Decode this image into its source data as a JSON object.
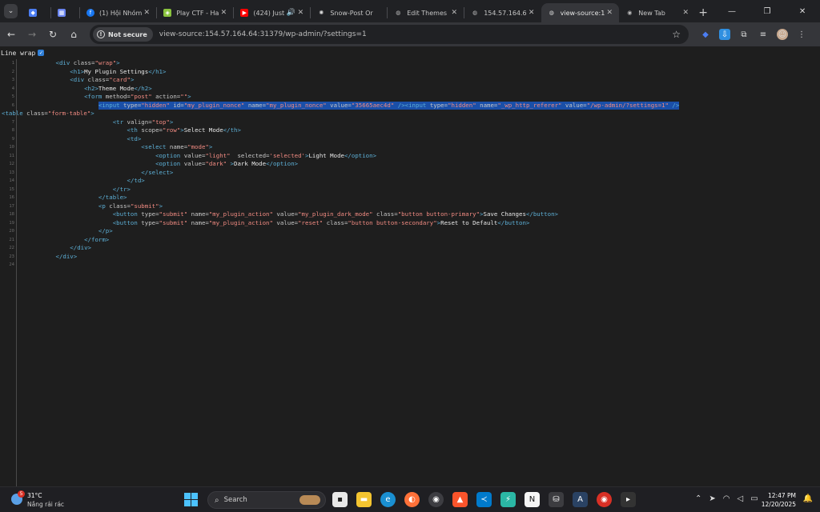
{
  "browser": {
    "tabs": [
      {
        "label": "",
        "favicon": "gem-icon",
        "color": "#4c7ef3"
      },
      {
        "label": "",
        "favicon": "calendar-icon",
        "color": "#6a85f0"
      },
      {
        "label": "(1) Hội Nhóm",
        "favicon": "facebook-icon",
        "color": "#1877f2"
      },
      {
        "label": "Play CTF - Ha",
        "favicon": "ctf-cube-icon",
        "color": "#8ac33e"
      },
      {
        "label": "(424) Just",
        "favicon": "youtube-icon",
        "color": "#ff0000"
      },
      {
        "label": "Snow-Post Or",
        "favicon": "snow-icon",
        "color": "#9aa0a6"
      },
      {
        "label": "Edit Themes",
        "favicon": "globe-icon",
        "color": "#9aa0a6"
      },
      {
        "label": "154.57.164.6",
        "favicon": "globe-icon",
        "color": "#9aa0a6"
      },
      {
        "label": "view-source:1",
        "favicon": "globe-icon",
        "color": "#9aa0a6"
      },
      {
        "label": "New Tab",
        "favicon": "chrome-icon",
        "color": "#9aa0a6"
      }
    ],
    "security_label": "Not secure",
    "url": "view-source:154.57.164.64:31379/wp-admin/?settings=1"
  },
  "viewsource": {
    "wrap_label": "Line wrap"
  },
  "source_lines": [
    {
      "n": "1",
      "indent": 5,
      "tokens": [
        [
          "t",
          "<div "
        ],
        [
          "a",
          "class="
        ],
        [
          "v",
          "\"wrap\""
        ],
        [
          "t",
          ">"
        ]
      ]
    },
    {
      "n": "2",
      "indent": 7,
      "tokens": [
        [
          "t",
          "<h1>"
        ],
        [
          "x",
          "My Plugin Settings"
        ],
        [
          "t",
          "</h1>"
        ]
      ]
    },
    {
      "n": "3",
      "indent": 7,
      "tokens": [
        [
          "t",
          "<div "
        ],
        [
          "a",
          "class="
        ],
        [
          "v",
          "\"card\""
        ],
        [
          "t",
          ">"
        ]
      ]
    },
    {
      "n": "4",
      "indent": 9,
      "tokens": [
        [
          "t",
          "<h2>"
        ],
        [
          "x",
          "Theme Mode"
        ],
        [
          "t",
          "</h2>"
        ]
      ]
    },
    {
      "n": "5",
      "indent": 9,
      "tokens": [
        [
          "t",
          "<form "
        ],
        [
          "a",
          "method="
        ],
        [
          "v",
          "\"post\""
        ],
        [
          "a",
          " action="
        ],
        [
          "v",
          "\"\""
        ],
        [
          "t",
          ">"
        ]
      ]
    },
    {
      "n": "6",
      "indent": 11,
      "hl": true,
      "tokens": [
        [
          "t",
          "<input "
        ],
        [
          "a",
          "type="
        ],
        [
          "v",
          "\"hidden\""
        ],
        [
          "a",
          " id="
        ],
        [
          "v",
          "\"my_plugin_nonce\""
        ],
        [
          "a",
          " name="
        ],
        [
          "v",
          "\"my_plugin_nonce\""
        ],
        [
          "a",
          " value="
        ],
        [
          "v",
          "\"35665aec4d\""
        ],
        [
          "t",
          " />"
        ],
        [
          "t",
          "<input "
        ],
        [
          "a",
          "type="
        ],
        [
          "v",
          "\"hidden\""
        ],
        [
          "a",
          " name="
        ],
        [
          "v",
          "\"_wp_http_referer\""
        ],
        [
          "a",
          " value="
        ],
        [
          "v",
          "\"/wp-admin/?settings=1\""
        ],
        [
          "t",
          " />"
        ]
      ]
    },
    {
      "n": "",
      "indent": 0,
      "tokens": [
        [
          "t",
          "<table "
        ],
        [
          "a",
          "class="
        ],
        [
          "v",
          "\"form-table\""
        ],
        [
          "t",
          ">"
        ]
      ]
    },
    {
      "n": "7",
      "indent": 13,
      "tokens": [
        [
          "t",
          "<tr "
        ],
        [
          "a",
          "valign="
        ],
        [
          "v",
          "\"top\""
        ],
        [
          "t",
          ">"
        ]
      ]
    },
    {
      "n": "8",
      "indent": 15,
      "tokens": [
        [
          "t",
          "<th "
        ],
        [
          "a",
          "scope="
        ],
        [
          "v",
          "\"row\""
        ],
        [
          "t",
          ">"
        ],
        [
          "x",
          "Select Mode"
        ],
        [
          "t",
          "</th>"
        ]
      ]
    },
    {
      "n": "9",
      "indent": 15,
      "tokens": [
        [
          "t",
          "<td>"
        ]
      ]
    },
    {
      "n": "10",
      "indent": 17,
      "tokens": [
        [
          "t",
          "<select "
        ],
        [
          "a",
          "name="
        ],
        [
          "v",
          "\"mode\""
        ],
        [
          "t",
          ">"
        ]
      ]
    },
    {
      "n": "11",
      "indent": 19,
      "tokens": [
        [
          "t",
          "<option "
        ],
        [
          "a",
          "value="
        ],
        [
          "v",
          "\"light\""
        ],
        [
          "a",
          "  selected="
        ],
        [
          "v",
          "'selected'"
        ],
        [
          "t",
          ">"
        ],
        [
          "x",
          "Light Mode"
        ],
        [
          "t",
          "</option>"
        ]
      ]
    },
    {
      "n": "12",
      "indent": 19,
      "tokens": [
        [
          "t",
          "<option "
        ],
        [
          "a",
          "value="
        ],
        [
          "v",
          "\"dark\""
        ],
        [
          "t",
          " >"
        ],
        [
          "x",
          "Dark Mode"
        ],
        [
          "t",
          "</option>"
        ]
      ]
    },
    {
      "n": "13",
      "indent": 17,
      "tokens": [
        [
          "t",
          "</select>"
        ]
      ]
    },
    {
      "n": "14",
      "indent": 15,
      "tokens": [
        [
          "t",
          "</td>"
        ]
      ]
    },
    {
      "n": "15",
      "indent": 13,
      "tokens": [
        [
          "t",
          "</tr>"
        ]
      ]
    },
    {
      "n": "16",
      "indent": 11,
      "tokens": [
        [
          "t",
          "</table>"
        ]
      ]
    },
    {
      "n": "17",
      "indent": 11,
      "tokens": [
        [
          "t",
          "<p "
        ],
        [
          "a",
          "class="
        ],
        [
          "v",
          "\"submit\""
        ],
        [
          "t",
          ">"
        ]
      ]
    },
    {
      "n": "18",
      "indent": 13,
      "tokens": [
        [
          "t",
          "<button "
        ],
        [
          "a",
          "type="
        ],
        [
          "v",
          "\"submit\""
        ],
        [
          "a",
          " name="
        ],
        [
          "v",
          "\"my_plugin_action\""
        ],
        [
          "a",
          " value="
        ],
        [
          "v",
          "\"my_plugin_dark_mode\""
        ],
        [
          "a",
          " class="
        ],
        [
          "v",
          "\"button button-primary\""
        ],
        [
          "t",
          ">"
        ],
        [
          "x",
          "Save Changes"
        ],
        [
          "t",
          "</button>"
        ]
      ]
    },
    {
      "n": "19",
      "indent": 13,
      "tokens": [
        [
          "t",
          "<button "
        ],
        [
          "a",
          "type="
        ],
        [
          "v",
          "\"submit\""
        ],
        [
          "a",
          " name="
        ],
        [
          "v",
          "\"my_plugin_action\""
        ],
        [
          "a",
          " value="
        ],
        [
          "v",
          "\"reset\""
        ],
        [
          "a",
          " class="
        ],
        [
          "v",
          "\"button button-secondary\""
        ],
        [
          "t",
          ">"
        ],
        [
          "x",
          "Reset to Default"
        ],
        [
          "t",
          "</button>"
        ]
      ]
    },
    {
      "n": "20",
      "indent": 11,
      "tokens": [
        [
          "t",
          "</p>"
        ]
      ]
    },
    {
      "n": "21",
      "indent": 9,
      "tokens": [
        [
          "t",
          "</form>"
        ]
      ]
    },
    {
      "n": "22",
      "indent": 7,
      "tokens": [
        [
          "t",
          "</div>"
        ]
      ]
    },
    {
      "n": "23",
      "indent": 5,
      "tokens": [
        [
          "t",
          "</div>"
        ]
      ]
    },
    {
      "n": "24",
      "indent": 0,
      "tokens": []
    }
  ],
  "taskbar": {
    "weather_badge": "5",
    "weather_temp": "31°C",
    "weather_condition": "Nắng rải rác",
    "search_placeholder": "Search",
    "clock_time": "12:47 PM",
    "clock_date": "12/20/2025"
  }
}
